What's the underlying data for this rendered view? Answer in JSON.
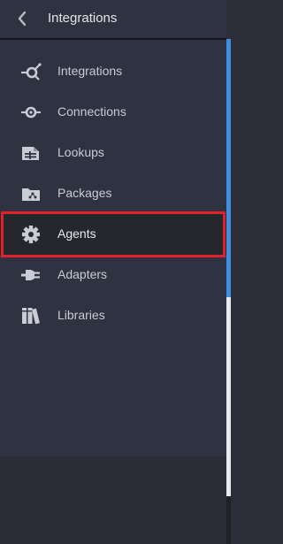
{
  "header": {
    "title": "Integrations",
    "back_icon": "chevron-left-icon"
  },
  "nav": {
    "items": [
      {
        "label": "Integrations",
        "icon": "integrations-hub-icon",
        "active": false
      },
      {
        "label": "Connections",
        "icon": "connections-plug-icon",
        "active": false
      },
      {
        "label": "Lookups",
        "icon": "lookups-table-icon",
        "active": false
      },
      {
        "label": "Packages",
        "icon": "packages-folder-icon",
        "active": false
      },
      {
        "label": "Agents",
        "icon": "gear-icon",
        "active": true
      },
      {
        "label": "Adapters",
        "icon": "adapter-plug-icon",
        "active": false
      },
      {
        "label": "Libraries",
        "icon": "libraries-books-icon",
        "active": false
      }
    ]
  },
  "colors": {
    "panel_bg": "#2f3240",
    "active_bg": "#26272c",
    "highlight_border": "#e3202b",
    "accent_strip": "#3d8ee0",
    "text": "#c9ccd4"
  }
}
